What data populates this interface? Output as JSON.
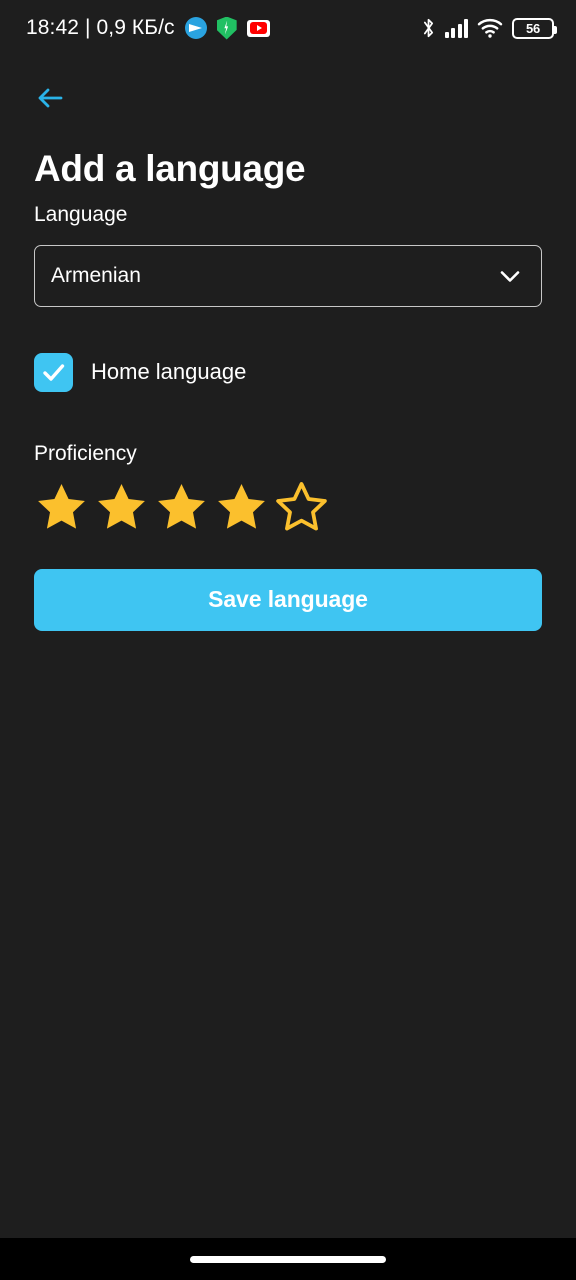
{
  "status_bar": {
    "time_and_speed": "18:42 | 0,9 КБ/с",
    "battery_level": "56",
    "notification_icons": [
      "telegram-icon",
      "shield-vpn-icon",
      "youtube-icon"
    ],
    "system_icons": [
      "bluetooth-icon",
      "cellular-signal-icon",
      "wifi-icon",
      "battery-icon"
    ]
  },
  "header": {
    "back_icon": "arrow-left-icon",
    "title": "Add a language"
  },
  "form": {
    "language": {
      "label": "Language",
      "selected": "Armenian",
      "dropdown_icon": "chevron-down-icon"
    },
    "home_language": {
      "label": "Home language",
      "checked": true,
      "check_icon": "check-icon"
    },
    "proficiency": {
      "label": "Proficiency",
      "rating": 4,
      "max_rating": 5,
      "star_filled_icon": "star-filled-icon",
      "star_empty_icon": "star-outline-icon"
    },
    "save_button": "Save language"
  },
  "nav_bar": {
    "gesture_pill": "home-gesture-pill"
  },
  "colors": {
    "background": "#1e1e1e",
    "accent": "#3fc5f2",
    "star": "#fbc02d",
    "text": "#ffffff",
    "border": "#c7c7c7",
    "nav_background": "#000000"
  }
}
